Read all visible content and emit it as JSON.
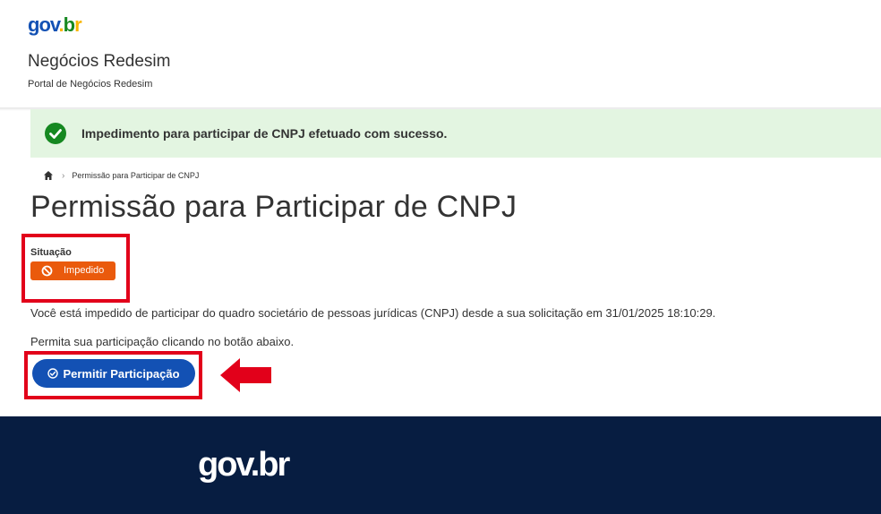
{
  "header": {
    "logo": {
      "p1": "gov",
      "p2": ".",
      "p3": "b",
      "p4": "r"
    },
    "title": "Negócios Redesim",
    "subtitle": "Portal de Negócios Redesim"
  },
  "alert": {
    "icon": "check-circle-icon",
    "message": "Impedimento para participar de CNPJ efetuado com sucesso."
  },
  "breadcrumb": {
    "home_icon": "home-icon",
    "current": "Permissão para Participar de CNPJ"
  },
  "page": {
    "title": "Permissão para Participar de CNPJ",
    "situation_label": "Situação",
    "status_badge": "Impedido",
    "status_icon": "ban-icon",
    "description": "Você está impedido de participar do quadro societário de pessoas jurídicas (CNPJ) desde a sua solicitação em 31/01/2025 18:10:29.",
    "instruction": "Permita sua participação clicando no botão abaixo.",
    "button_label": "Permitir Participação",
    "button_icon": "check-circle-icon"
  },
  "footer": {
    "logo": "gov.br"
  },
  "colors": {
    "primary": "#1351b4",
    "success_bg": "#e3f5e1",
    "success": "#168821",
    "badge": "#ea5a0c",
    "footer": "#071d41",
    "highlight": "#e2001a"
  }
}
